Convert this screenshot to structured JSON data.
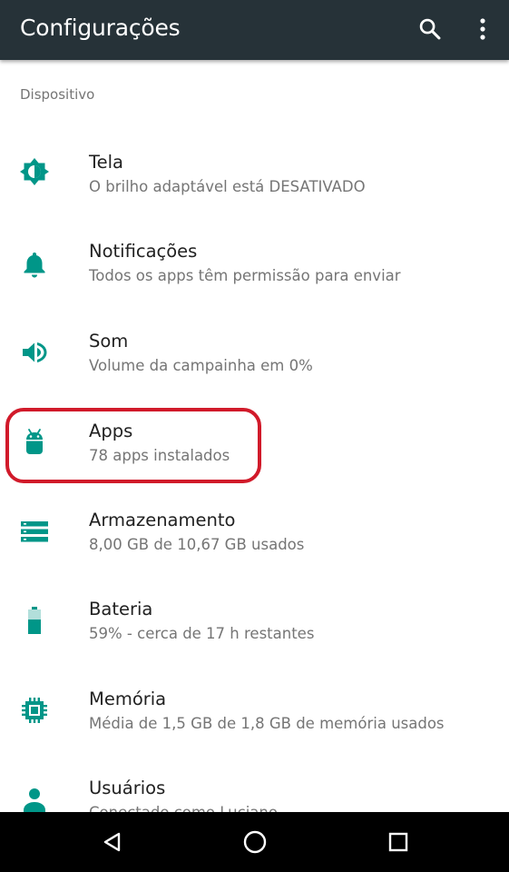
{
  "toolbar": {
    "title": "Configurações",
    "background": "#263238",
    "actions": [
      "search-icon",
      "more-vert-icon"
    ]
  },
  "section": {
    "header": "Dispositivo"
  },
  "accent_color": "#009688",
  "highlight_color": "#d11a2a",
  "items": [
    {
      "title": "Tela",
      "summary": "O brilho adaptável está DESATIVADO",
      "icon": "brightness-icon"
    },
    {
      "title": "Notificações",
      "summary": "Todos os apps têm permissão para enviar",
      "icon": "bell-icon"
    },
    {
      "title": "Som",
      "summary": "Volume da campainha em 0%",
      "icon": "volume-icon"
    },
    {
      "title": "Apps",
      "summary": "78 apps instalados",
      "icon": "android-icon",
      "highlighted": true
    },
    {
      "title": "Armazenamento",
      "summary": "8,00 GB de 10,67 GB usados",
      "icon": "storage-icon"
    },
    {
      "title": "Bateria",
      "summary": "59% - cerca de 17 h restantes",
      "icon": "battery-icon",
      "battery_level": 0.59
    },
    {
      "title": "Memória",
      "summary": "Média de 1,5 GB de 1,8 GB de memória usados",
      "icon": "memory-icon"
    },
    {
      "title": "Usuários",
      "summary": "Conectado como Luciano",
      "icon": "person-icon"
    }
  ],
  "navbar": {
    "buttons": [
      "back-icon",
      "home-icon",
      "recents-icon"
    ]
  }
}
